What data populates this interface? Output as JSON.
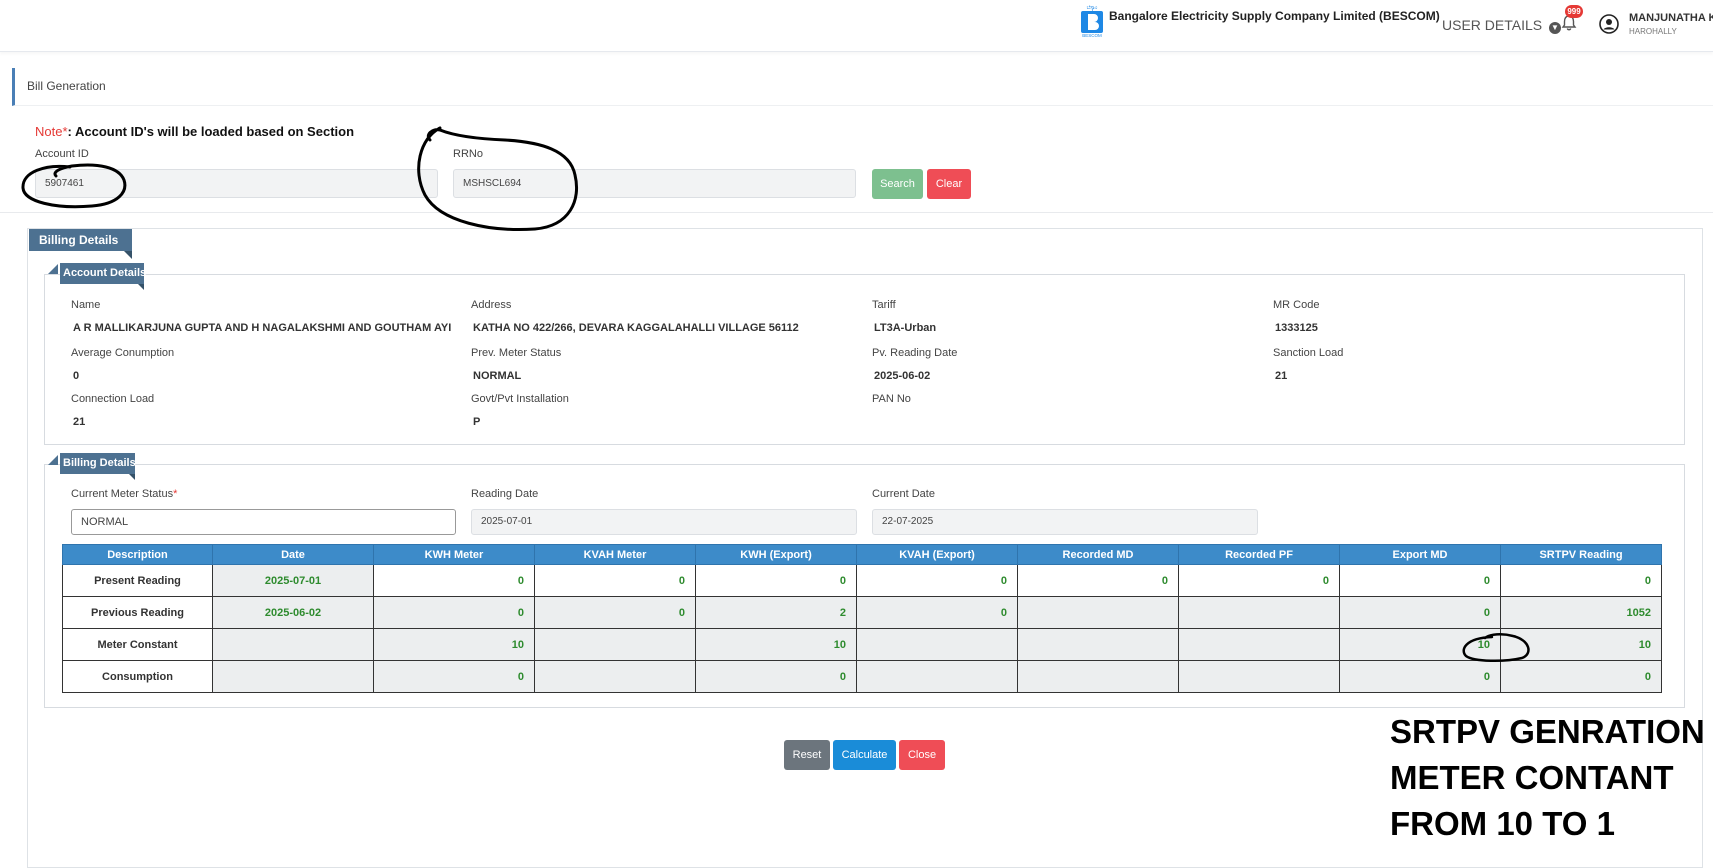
{
  "header": {
    "company_name": "Bangalore Electricity Supply Company Limited (BESCOM)",
    "user_details_label": "USER DETAILS",
    "notification_count": "999",
    "user_name": "MANJUNATHA K",
    "user_location": "HAROHALLY"
  },
  "page_title": "Bill Generation",
  "search": {
    "note_prefix": "Note*",
    "note_text": ": Account ID's will be loaded based on Section",
    "account_id_label": "Account ID",
    "account_id_value": "5907461",
    "rrno_label": "RRNo",
    "rrno_value": "MSHSCL694",
    "search_button": "Search",
    "clear_button": "Clear"
  },
  "billing_panel_title": "Billing Details",
  "account_details": {
    "title": "Account Details",
    "name_label": "Name",
    "name_value": "A R MALLIKARJUNA GUPTA AND H NAGALAKSHMI AND GOUTHAM AYI",
    "address_label": "Address",
    "address_value": "KATHA NO 422/266, DEVARA KAGGALAHALLI VILLAGE 56112",
    "tariff_label": "Tariff",
    "tariff_value": "LT3A-Urban",
    "mr_code_label": "MR Code",
    "mr_code_value": "1333125",
    "avg_consumption_label": "Average Conumption",
    "avg_consumption_value": "0",
    "prev_meter_status_label": "Prev. Meter Status",
    "prev_meter_status_value": "NORMAL",
    "pv_reading_date_label": "Pv. Reading Date",
    "pv_reading_date_value": "2025-06-02",
    "sanction_load_label": "Sanction Load",
    "sanction_load_value": "21",
    "connection_load_label": "Connection Load",
    "connection_load_value": "21",
    "installation_label": "Govt/Pvt Installation",
    "installation_value": "P",
    "pan_label": "PAN No",
    "pan_value": ""
  },
  "billing_details": {
    "title": "Billing Details",
    "meter_status_label": "Current Meter Status",
    "meter_status_required": "*",
    "meter_status_value": "NORMAL",
    "reading_date_label": "Reading Date",
    "reading_date_value": "2025-07-01",
    "current_date_label": "Current Date",
    "current_date_value": "22-07-2025"
  },
  "readings_table": {
    "columns": [
      "Description",
      "Date",
      "KWH Meter",
      "KVAH Meter",
      "KWH (Export)",
      "KVAH (Export)",
      "Recorded MD",
      "Recorded PF",
      "Export MD",
      "SRTPV Reading"
    ],
    "rows": [
      {
        "cells": [
          "Present Reading",
          "2025-07-01",
          "0",
          "0",
          "0",
          "0",
          "0",
          "0",
          "0",
          "0"
        ]
      },
      {
        "cells": [
          "Previous Reading",
          "2025-06-02",
          "0",
          "0",
          "2",
          "0",
          "",
          "",
          "0",
          "1052"
        ]
      },
      {
        "cells": [
          "Meter Constant",
          "",
          "10",
          "",
          "10",
          "",
          "",
          "",
          "10",
          "10"
        ]
      },
      {
        "cells": [
          "Consumption",
          "",
          "0",
          "",
          "0",
          "",
          "",
          "",
          "0",
          "0"
        ]
      }
    ]
  },
  "actions": {
    "reset": "Reset",
    "calculate": "Calculate",
    "close": "Close"
  },
  "annotation_lines": [
    "SRTPV GENRATION",
    "METER CONTANT",
    "FROM 10 TO 1"
  ],
  "colors": {
    "search_button": "#7dc08f",
    "danger": "#ef4d56",
    "primary": "#1a8cd8",
    "secondary": "#6c757d",
    "header_blue": "#3d8bc9",
    "panel_tab": "#4d7191",
    "value_green": "#2e8b2e"
  }
}
